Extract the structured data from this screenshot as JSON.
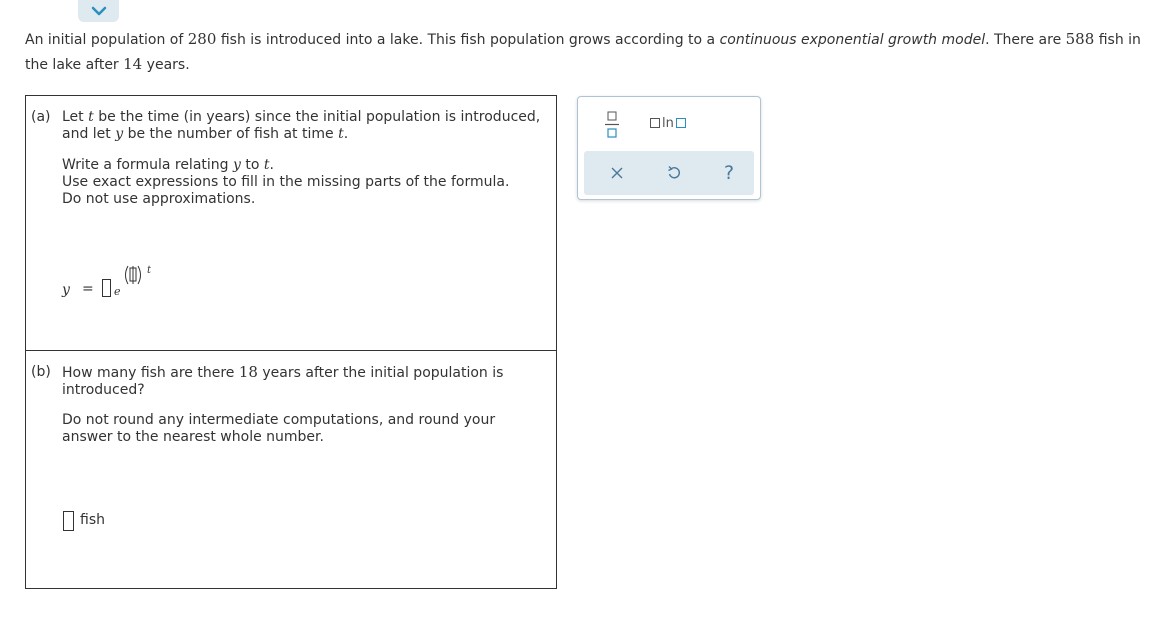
{
  "intro": {
    "p1": "An initial population of ",
    "n1": "280",
    "p2": " fish is introduced into a lake. This fish population grows according to a ",
    "model": "continuous exponential growth model",
    "p3": ". There are ",
    "n2": "588",
    "p4": " fish in the lake after ",
    "n3": "14",
    "p5": " years."
  },
  "part_a": {
    "letter": "(a)",
    "l1a": "Let ",
    "var_t": "t",
    "l1b": " be the time (in years) since the initial population is introduced,",
    "l2a": "and let ",
    "var_y": "y",
    "l2b": " be the number of fish at time ",
    "l2c": ".",
    "l3a": "Write a formula relating ",
    "l3b": " to ",
    "l3c": ".",
    "l4": "Use exact expressions to fill in the missing parts of the formula.",
    "l5": "Do not use approximations.",
    "formula": {
      "lhs": "y",
      "equals": "=",
      "base": "e",
      "exp_var": "t"
    }
  },
  "part_b": {
    "letter": "(b)",
    "l1a": "How many fish are there ",
    "years": "18",
    "l1b": " years after the initial population is",
    "l2": "introduced?",
    "l3": "Do not round any intermediate computations, and round your",
    "l4": "answer to the nearest whole number.",
    "unit": "fish"
  },
  "palette": {
    "ln_label": "ln",
    "help_label": "?"
  },
  "colors": {
    "accent": "#2a8fbd",
    "palette_bg": "#dfe9f0",
    "border": "#333333"
  },
  "icons": {
    "collapse": "chevron-down-icon",
    "fraction": "fraction-icon",
    "log": "ln-icon",
    "clear": "close-icon",
    "undo": "undo-icon",
    "help": "help-icon"
  }
}
